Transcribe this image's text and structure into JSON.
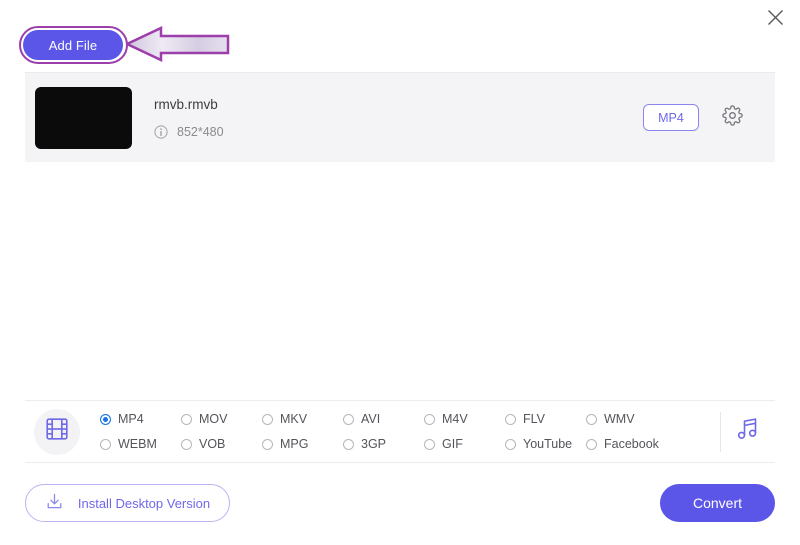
{
  "window": {
    "close_label": "×",
    "close_icon": "close-icon"
  },
  "toolbar": {
    "add_file_label": "Add File"
  },
  "annotation": {
    "ring_color": "#9c3faa",
    "arrow_outline_color": "#9c3faa",
    "arrow_fill_color": "#d9d2e6",
    "points_to": "Add File"
  },
  "file_list": {
    "rows": [
      {
        "thumbnail": "video-thumbnail",
        "name": "rmvb.rmvb",
        "info_icon": "info-icon",
        "resolution": "852*480",
        "output_format_label": "MP4",
        "settings_icon": "gear-icon"
      }
    ]
  },
  "format_bar": {
    "media_type_icon": "film-strip-icon",
    "audio_icon": "music-note-icon",
    "selected": "MP4",
    "options": [
      {
        "label": "MP4",
        "selected": true
      },
      {
        "label": "MOV",
        "selected": false
      },
      {
        "label": "MKV",
        "selected": false
      },
      {
        "label": "AVI",
        "selected": false
      },
      {
        "label": "M4V",
        "selected": false
      },
      {
        "label": "FLV",
        "selected": false
      },
      {
        "label": "WMV",
        "selected": false
      },
      {
        "label": "WEBM",
        "selected": false
      },
      {
        "label": "VOB",
        "selected": false
      },
      {
        "label": "MPG",
        "selected": false
      },
      {
        "label": "3GP",
        "selected": false
      },
      {
        "label": "GIF",
        "selected": false
      },
      {
        "label": "YouTube",
        "selected": false
      },
      {
        "label": "Facebook",
        "selected": false
      }
    ]
  },
  "footer": {
    "install_label": "Install Desktop Version",
    "install_icon": "download-icon",
    "convert_label": "Convert"
  },
  "colors": {
    "accent": "#5b55e8",
    "accent_light": "#6f69e8",
    "radio_selected": "#1a73e8",
    "row_bg": "#f4f4f6",
    "annotation": "#9c3faa"
  }
}
